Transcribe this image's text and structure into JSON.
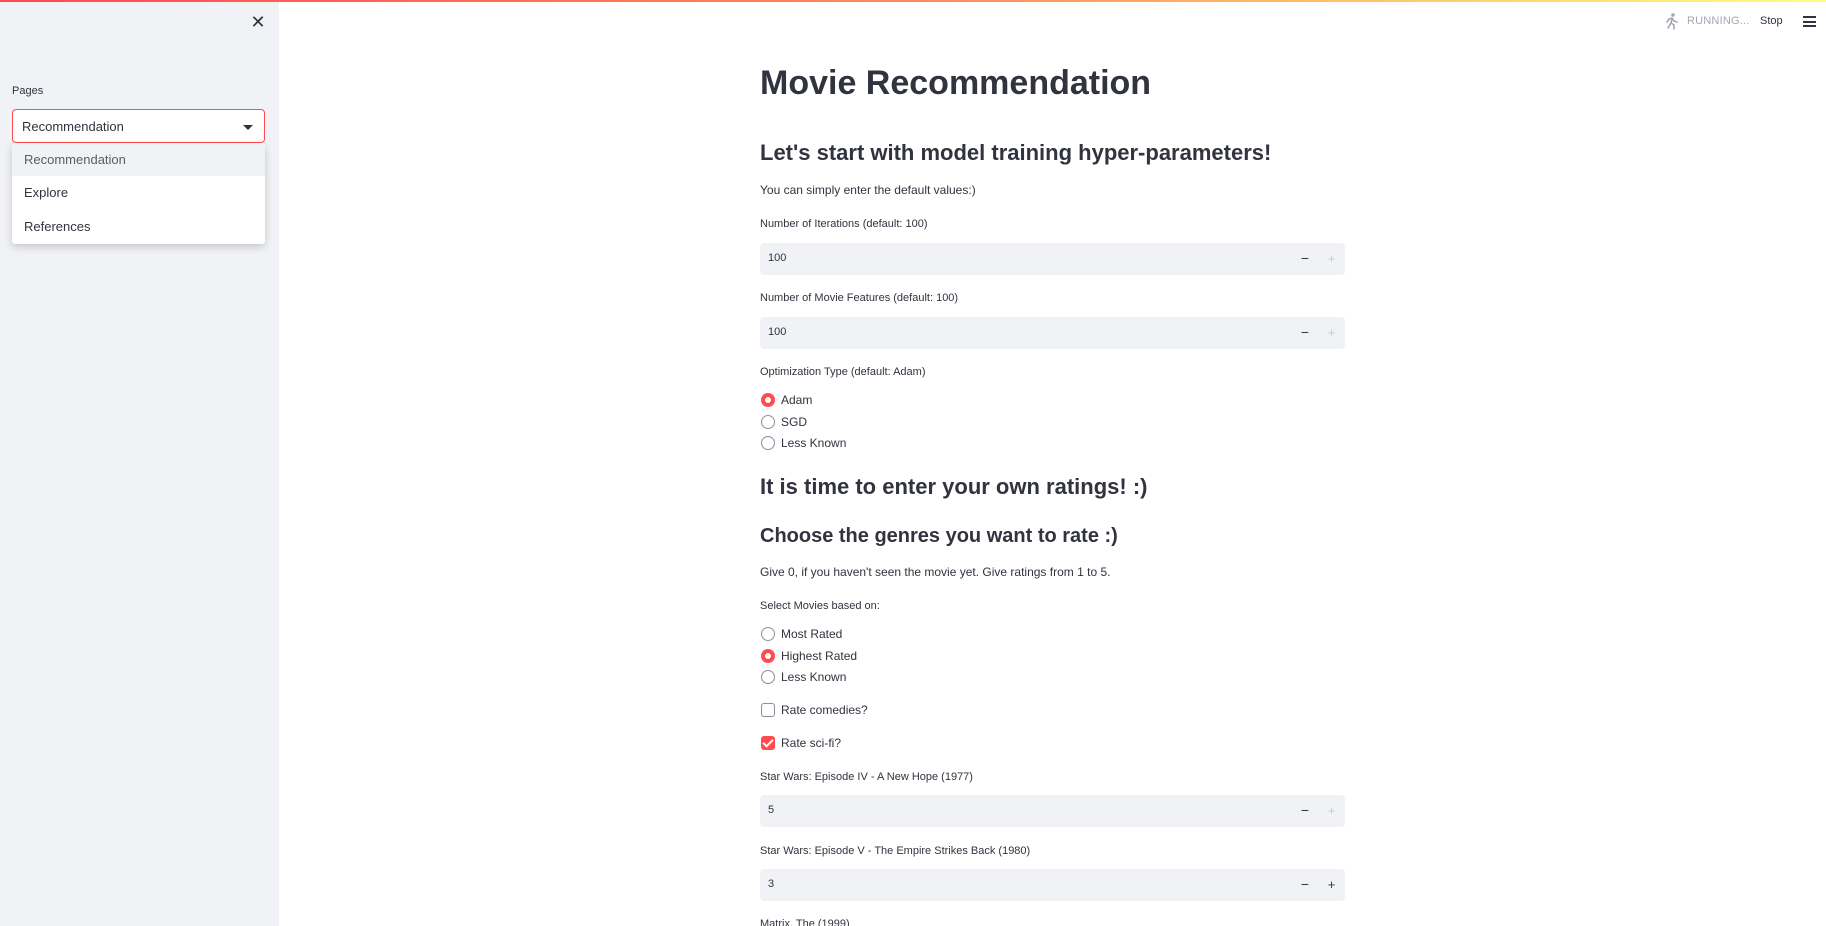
{
  "colors": {
    "accent": "#ff4b4b",
    "sidebar_bg": "#f0f2f6",
    "text": "#31333f"
  },
  "sidebar": {
    "close_icon": "close-icon",
    "pages_label": "Pages",
    "selected": "Recommendation",
    "options": [
      "Recommendation",
      "Explore",
      "References"
    ]
  },
  "status": {
    "running": "RUNNING...",
    "stop": "Stop",
    "menu_icon": "hamburger-menu-icon",
    "running_icon": "running-person-icon"
  },
  "main": {
    "title": "Movie Recommendation",
    "training_header": "Let's start with model training hyper-parameters!",
    "training_hint": "You can simply enter the default values:)",
    "iterations": {
      "label": "Number of Iterations (default: 100)",
      "value": "100"
    },
    "features": {
      "label": "Number of Movie Features (default: 100)",
      "value": "100"
    },
    "optimization": {
      "label": "Optimization Type (default: Adam)",
      "options": [
        "Adam",
        "SGD",
        "Less Known"
      ],
      "selected": "Adam"
    },
    "ratings_header": "It is time to enter your own ratings! :)",
    "genres_header": "Choose the genres you want to rate :)",
    "genres_hint": "Give 0, if you haven't seen the movie yet. Give ratings from 1 to 5.",
    "select_movies": {
      "label": "Select Movies based on:",
      "options": [
        "Most Rated",
        "Highest Rated",
        "Less Known"
      ],
      "selected": "Highest Rated"
    },
    "rate_comedies": {
      "label": "Rate comedies?",
      "checked": false
    },
    "rate_scifi": {
      "label": "Rate sci-fi?",
      "checked": true
    },
    "movies": [
      {
        "label": "Star Wars: Episode IV - A New Hope (1977)",
        "value": "5"
      },
      {
        "label": "Star Wars: Episode V - The Empire Strikes Back (1980)",
        "value": "3"
      },
      {
        "label": "Matrix, The (1999)"
      }
    ],
    "minus": "−",
    "plus": "+"
  }
}
